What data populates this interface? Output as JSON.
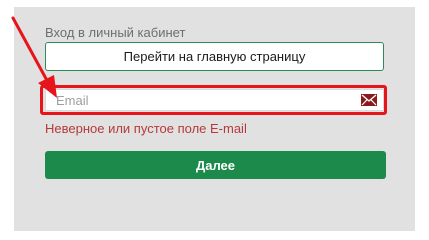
{
  "login": {
    "heading": "Вход в личный кабинет",
    "home_button_label": "Перейти на главную страницу",
    "email": {
      "value": "",
      "placeholder": "Email",
      "icon": "envelope-icon"
    },
    "error_message": "Неверное или пустое поле E-mail",
    "submit_label": "Далее"
  },
  "colors": {
    "panel_background": "#e1e1e1",
    "accent_green": "#1b8a4a",
    "annotation_red": "#e8141b",
    "error_text": "#b53a3a"
  }
}
